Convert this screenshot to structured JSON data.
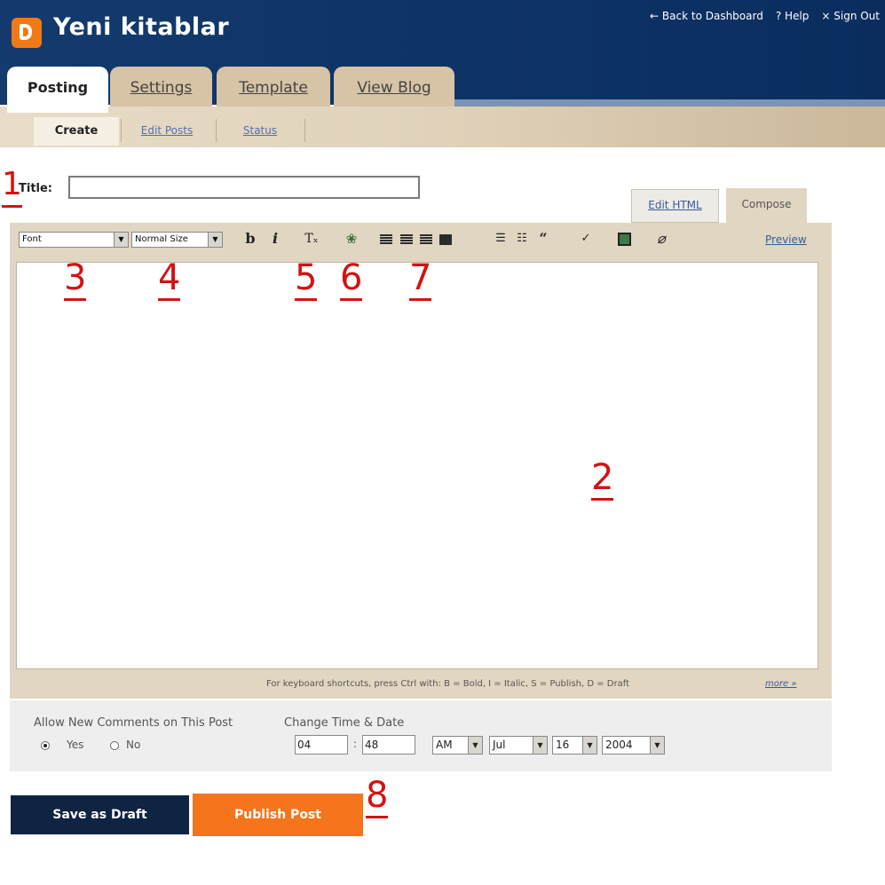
{
  "app": {
    "blog_title": "Yeni kitablar",
    "brand_color": "#f07a15"
  },
  "top_links": {
    "back": "← Back to Dashboard",
    "help": "? Help",
    "signout": "× Sign Out"
  },
  "tabs": [
    {
      "label": "Posting",
      "active": true
    },
    {
      "label": "Settings",
      "active": false
    },
    {
      "label": "Template",
      "active": false
    },
    {
      "label": "View Blog",
      "active": false
    }
  ],
  "subtabs": [
    {
      "label": "Create",
      "active": true
    },
    {
      "label": "Edit Posts",
      "active": false
    },
    {
      "label": "Status",
      "active": false
    }
  ],
  "post": {
    "title_label": "Title:",
    "title_value": ""
  },
  "editor": {
    "mode_tabs": [
      "Edit HTML",
      "Compose"
    ],
    "active_mode": "Compose",
    "font_select": "Font",
    "size_select": "Normal Size",
    "toolbar": {
      "bold": "b",
      "italic": "i",
      "remove_format": "Tₓ",
      "text_color": "❀",
      "ordered_list": "☰",
      "unordered_list": "☷",
      "blockquote": "“",
      "spell_check": "✓",
      "eraser": "⌀"
    },
    "preview": "Preview",
    "shortcuts_text": "For keyboard shortcuts, press Ctrl with: B = Bold, I = Italic, S = Publish, D = Draft",
    "shortcuts_more": "more »"
  },
  "options": {
    "comments_label": "Allow New Comments on This Post",
    "yes": "Yes",
    "no": "No",
    "comments_selected": "Yes",
    "time_label": "Change Time & Date",
    "hour": "04",
    "minute": "48",
    "colon": ":",
    "ampm": "AM",
    "month": "Jul",
    "day": "16",
    "year": "2004"
  },
  "buttons": {
    "save_draft": "Save as Draft",
    "publish": "Publish Post"
  },
  "annotations": [
    "1",
    "2",
    "3",
    "4",
    "5",
    "6",
    "7",
    "8"
  ]
}
